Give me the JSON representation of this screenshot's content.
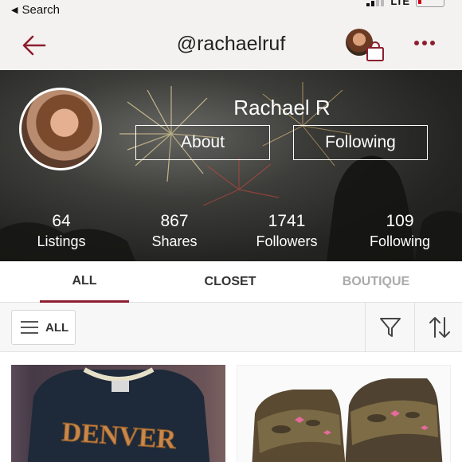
{
  "status_bar": {
    "back_label": "Search",
    "network": "LTE"
  },
  "header": {
    "title": "@rachaelruf"
  },
  "profile": {
    "name": "Rachael R",
    "about_label": "About",
    "following_button_label": "Following",
    "stats": [
      {
        "value": "64",
        "label": "Listings"
      },
      {
        "value": "867",
        "label": "Shares"
      },
      {
        "value": "1741",
        "label": "Followers"
      },
      {
        "value": "109",
        "label": "Following"
      }
    ]
  },
  "tabs": [
    {
      "label": "ALL",
      "active": true
    },
    {
      "label": "CLOSET",
      "active": false
    },
    {
      "label": "BOUTIQUE",
      "active": false
    }
  ],
  "filter_bar": {
    "all_label": "ALL"
  },
  "listings": [
    {
      "image": "navy Denver t-shirt",
      "print": "DENVER"
    },
    {
      "image": "camo slide sandals"
    }
  ],
  "colors": {
    "accent": "#8c1f2f",
    "header_bg": "#f4f2f1",
    "hero_overlay": "#2a2a28"
  },
  "icons": [
    "back-arrow-icon",
    "bag-icon",
    "more-icon",
    "menu-icon",
    "filter-icon",
    "sort-icon"
  ]
}
